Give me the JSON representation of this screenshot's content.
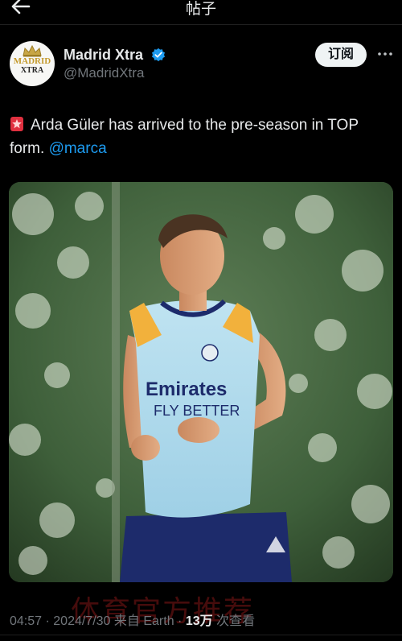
{
  "header": {
    "title": "帖子",
    "back_icon": "arrow-left-icon"
  },
  "author": {
    "avatar_line1": "MADRID",
    "avatar_line2": "XTRA",
    "name": "Madrid Xtra",
    "handle": "@MadridXtra",
    "verified_color": "#1d9bf0"
  },
  "actions": {
    "follow_label": "订阅",
    "more_icon": "more-horizontal-icon"
  },
  "tweet": {
    "emoji_icon": "red-card-emoji",
    "text": "Arda Güler has arrived to the pre-season in TOP form.",
    "mention": "@marca",
    "media_shirt_line1": "Emirates",
    "media_shirt_line2": "FLY BETTER"
  },
  "meta": {
    "time": "04:57",
    "date": "2024/7/30",
    "source": "来自 Earth",
    "views": "13万",
    "views_suffix": "次查看"
  },
  "watermark": "体育官方推荐",
  "colors": {
    "background": "#000000",
    "accent": "#1d9bf0",
    "secondary_text": "#71767b"
  }
}
